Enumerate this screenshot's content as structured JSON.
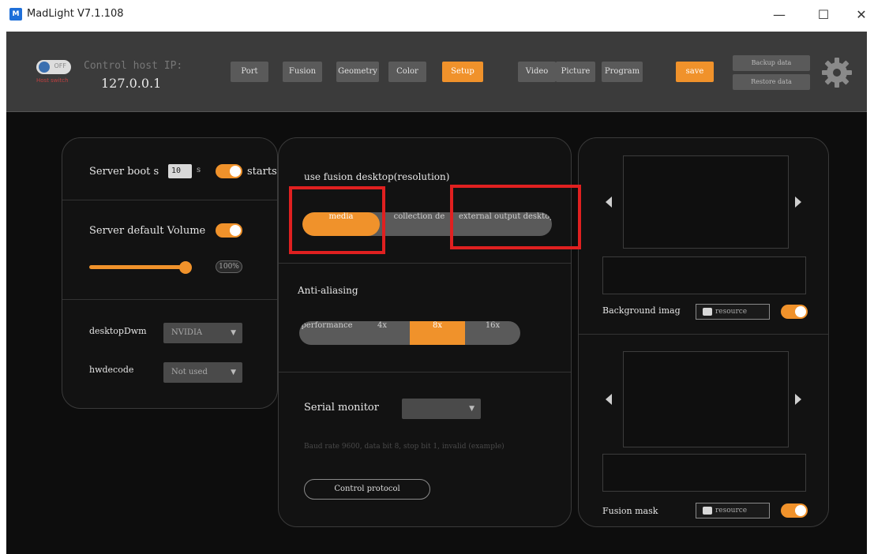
{
  "window": {
    "title": "MadLight V7.1.108",
    "minimize": "—",
    "maximize": "☐",
    "close": "✕"
  },
  "toolbar": {
    "host_toggle_label": "OFF",
    "host_toggle_sub": "Host switch",
    "control_host_label": "Control host IP:",
    "control_host_ip": "127.0.0.1",
    "buttons": [
      "Port",
      "Fusion",
      "Geometry",
      "Color",
      "Setup",
      "Video",
      "Picture",
      "Program",
      "save"
    ],
    "active_button": "Setup",
    "backup_label": "Backup data",
    "restore_label": "Restore data"
  },
  "left_panel": {
    "server_boot_label": "Server boot s",
    "server_boot_value": "10",
    "server_boot_unit": "s",
    "starts_label": "starts",
    "server_volume_label": "Server default Volume",
    "volume_percent": "100%",
    "volume_level": 1.0,
    "desktop_label": "desktopDwm",
    "desktop_value": "NVIDIA",
    "hwdecode_label": "hwdecode",
    "hwdecode_value": "Not used"
  },
  "center_panel": {
    "fusion_label": "use fusion desktop(resolution)",
    "fusion_options": [
      "media",
      "collection de",
      "external output desktop"
    ],
    "fusion_active": "media",
    "anti_aliasing_label": "Anti-aliasing",
    "aa_options": [
      "performance",
      "4x",
      "8x",
      "16x"
    ],
    "aa_active": "8x",
    "serial_monitor_label": "Serial monitor",
    "serial_monitor_value": "",
    "serial_hint": "Baud rate 9600, data bit 8, stop bit 1, invalid (example)",
    "control_protocol_label": "Control protocol"
  },
  "right_panel": {
    "background_label": "Background imag",
    "background_resource": "resource",
    "fusion_mask_label": "Fusion mask",
    "fusion_mask_resource": "resource"
  },
  "colors": {
    "accent": "#f0922b",
    "highlight": "#e02020",
    "background": "#0d0d0d",
    "toolbar": "#3b3b3b"
  }
}
